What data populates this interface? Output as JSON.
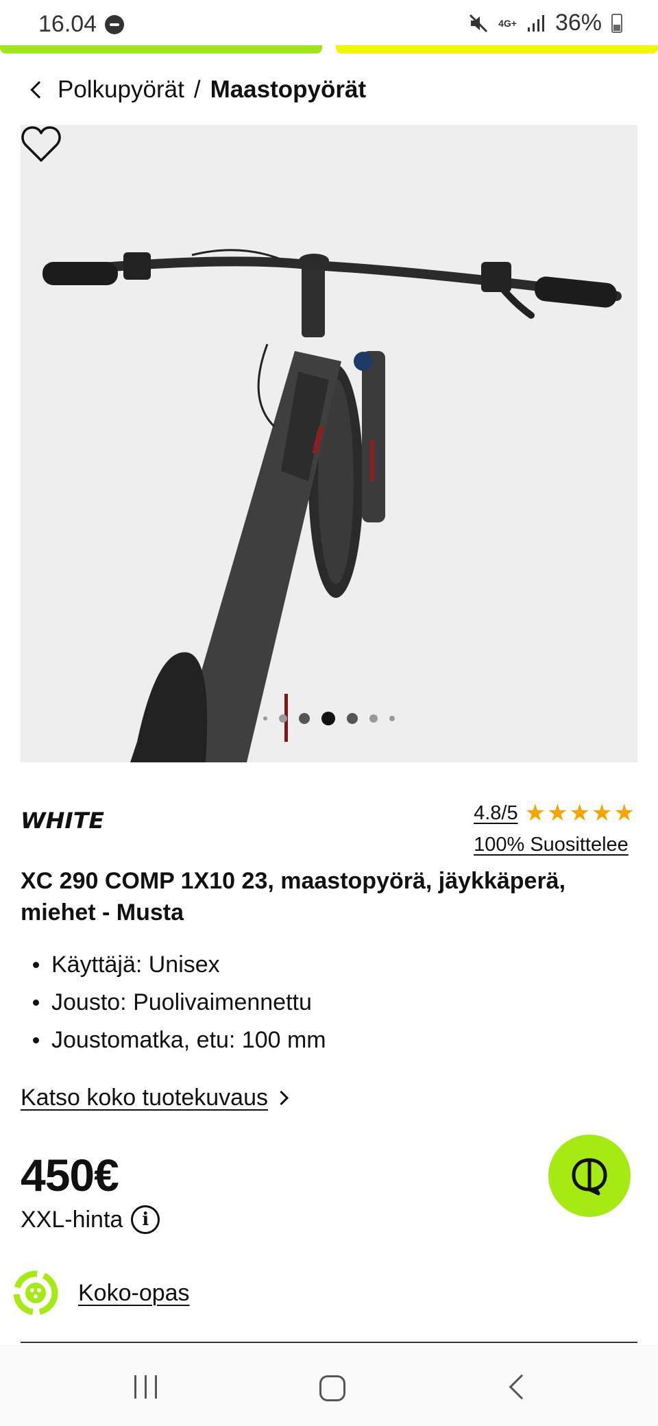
{
  "status_bar": {
    "time": "16.04",
    "network": "4G+",
    "battery": "36%"
  },
  "breadcrumb": {
    "parent": "Polkupyörät",
    "separator": "/",
    "current": "Maastopyörät"
  },
  "gallery": {
    "dot_count": 7,
    "active_dot_index": 3
  },
  "brand": {
    "name": "WHITE"
  },
  "rating": {
    "score": "4.8/5",
    "stars": "★★★★★",
    "recommend": "100% Suosittelee"
  },
  "product": {
    "title": "XC 290 COMP 1X10 23, maastopyörä, jäykkäperä, miehet - Musta",
    "features": [
      "Käyttäjä: Unisex",
      "Jousto: Puolivaimennettu",
      "Joustomatka, etu: 100 mm"
    ],
    "full_description_link": "Katso koko tuotekuvaus",
    "price": "450€",
    "price_label": "XXL-hinta",
    "size_guide": "Koko-opas"
  },
  "colors": {
    "accent_green": "#a6ea14",
    "accent_yellow": "#f1f500",
    "star": "#f5a400"
  }
}
